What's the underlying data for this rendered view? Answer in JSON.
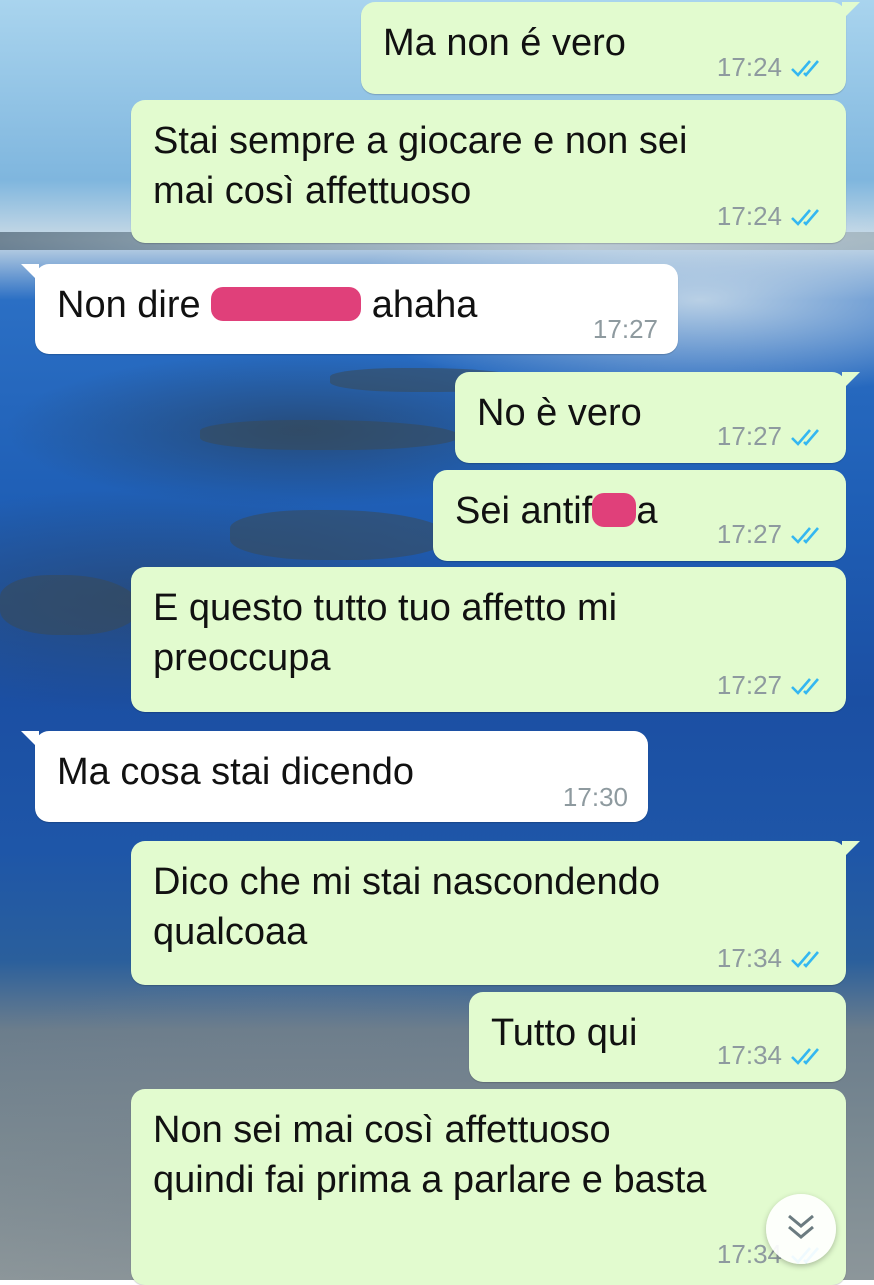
{
  "messages": [
    {
      "direction": "out",
      "text": "Ma non é vero",
      "time": "17:24",
      "status": "read"
    },
    {
      "direction": "out",
      "text": "Stai sempre a giocare e non sei\nmai così affettuoso",
      "time": "17:24",
      "status": "read"
    },
    {
      "direction": "in",
      "text_before": "Non dire ",
      "text_after": " ahaha",
      "time": "17:27"
    },
    {
      "direction": "out",
      "text": "No è vero",
      "time": "17:27",
      "status": "read"
    },
    {
      "direction": "out",
      "text_before": "Sei antif",
      "text_after": "a",
      "time": "17:27",
      "status": "read"
    },
    {
      "direction": "out",
      "text": "E questo tutto tuo affetto mi\npreoccupa",
      "time": "17:27",
      "status": "read"
    },
    {
      "direction": "in",
      "text": "Ma cosa stai dicendo",
      "time": "17:30"
    },
    {
      "direction": "out",
      "text": "Dico che mi stai nascondendo\nqualcoaa",
      "time": "17:34",
      "status": "read"
    },
    {
      "direction": "out",
      "text": "Tutto qui",
      "time": "17:34",
      "status": "read"
    },
    {
      "direction": "out",
      "text": "Non sei mai così affettuoso\nquindi fai prima a parlare e basta",
      "time": "17:34",
      "status": "read"
    }
  ],
  "colors": {
    "outgoing_bubble": "#e2fbcf",
    "incoming_bubble": "#ffffff",
    "read_ticks": "#34b7f1",
    "redaction": "#e0407a",
    "timestamp": "#8e9a9f"
  },
  "icons": {
    "read_receipt": "double-check-icon",
    "scroll_down": "double-chevron-down-icon"
  }
}
